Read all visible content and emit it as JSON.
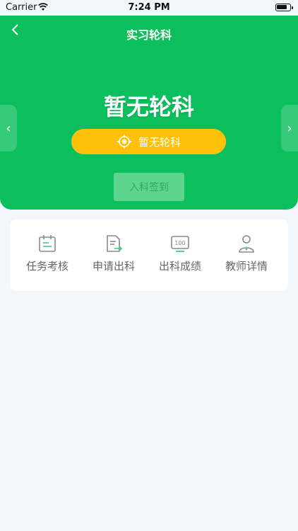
{
  "status_bar": {
    "carrier": "Carrier",
    "time": "7:24 PM"
  },
  "header": {
    "title": "实习轮科",
    "back_icon": "chevron-left-icon"
  },
  "hero": {
    "big_title": "暂无轮科",
    "pill_label": "暂无轮科",
    "checkin_button": "入科签到"
  },
  "menu": {
    "items": [
      {
        "label": "任务考核",
        "icon": "calendar-task-icon"
      },
      {
        "label": "申请出科",
        "icon": "document-export-icon"
      },
      {
        "label": "出科成绩",
        "icon": "score-100-icon"
      },
      {
        "label": "教师详情",
        "icon": "teacher-icon"
      }
    ]
  },
  "colors": {
    "primary_green": "#0bbf5d",
    "pill_yellow": "#ffc107",
    "page_bg": "#f3f7fc",
    "card_bg": "#ffffff",
    "checkin_bg": "#5fd48f"
  }
}
